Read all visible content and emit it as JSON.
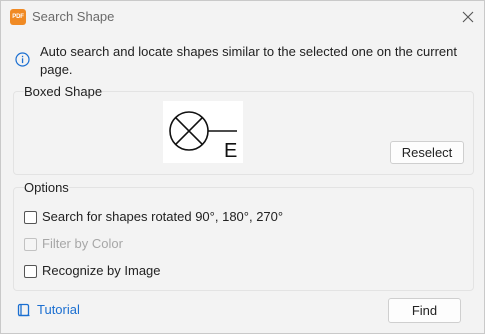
{
  "window": {
    "app_icon_text": "PDF",
    "title": "Search Shape",
    "close_icon": "close-icon"
  },
  "info": {
    "icon": "info-icon",
    "text": "Auto search and locate shapes similar to the selected one on the current page."
  },
  "boxed_shape": {
    "label": "Boxed Shape",
    "preview_letter": "E",
    "reselect_label": "Reselect"
  },
  "options": {
    "label": "Options",
    "items": [
      {
        "label": "Search for shapes rotated 90°, 180°, 270°",
        "checked": false,
        "enabled": true
      },
      {
        "label": "Filter by Color",
        "checked": false,
        "enabled": false
      },
      {
        "label": "Recognize by Image",
        "checked": false,
        "enabled": true
      }
    ]
  },
  "footer": {
    "tutorial_icon": "book-icon",
    "tutorial_label": "Tutorial",
    "find_label": "Find"
  },
  "colors": {
    "accent": "#1b6fd1",
    "logo": "#f08a24",
    "dialog_bg": "#f3f3f3"
  }
}
